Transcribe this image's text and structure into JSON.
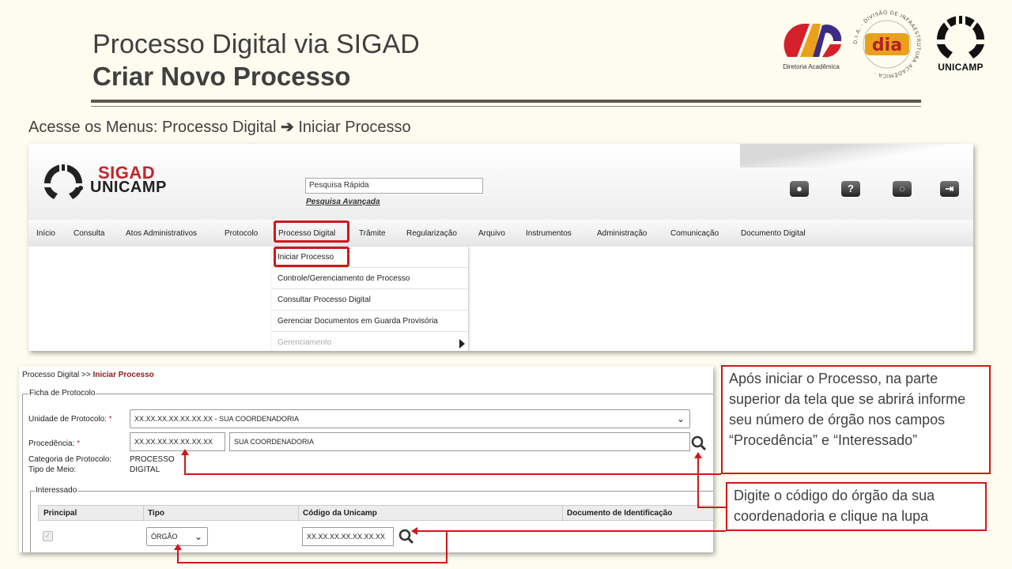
{
  "slide": {
    "title": "Processo Digital via SIGAD",
    "subtitle": "Criar Novo Processo",
    "instruction_prefix": "Acesse os Menus: Processo Digital",
    "instruction_arrow": "➔",
    "instruction_suffix": "Iniciar Processo"
  },
  "logos": {
    "dac_caption": "Diretoria Acadêmica",
    "dia_text": "dia",
    "dia_ring": "D.I.A. · DIVISÃO DE INFRAESTRUTURA ACADÊMICA ·",
    "unicamp_text": "UNICAMP"
  },
  "sigad": {
    "brand_top": "SIGAD",
    "brand_bottom": "UNICAMP",
    "quick_search_placeholder": "Pesquisa Rápida",
    "advanced_search": "Pesquisa Avançada",
    "header_icons": [
      "user-icon",
      "help-icon",
      "chat-icon",
      "exit-icon"
    ],
    "nav": [
      "Início",
      "Consulta",
      "Atos Administrativos",
      "Protocolo",
      "Processo Digital",
      "Trâmite",
      "Regularização",
      "Arquivo",
      "Instrumentos",
      "Administração",
      "Comunicação",
      "Documento Digital"
    ],
    "dropdown": [
      "Iniciar Processo",
      "Controle/Gerenciamento de Processo",
      "Consultar Processo Digital",
      "Gerenciar Documentos em Guarda Provisória",
      "Gerenciamento"
    ]
  },
  "form": {
    "breadcrumb_prefix": "Processo Digital >>",
    "breadcrumb_current": "Iniciar Processo",
    "fieldset_ficha": "Ficha de Protocolo",
    "unidade_label": "Unidade de Protocolo:",
    "unidade_value": "XX.XX.XX.XX.XX.XX.XX - SUA COORDENADORIA",
    "procedencia_label": "Procedência:",
    "procedencia_code": "XX.XX.XX.XX.XX.XX.XX",
    "procedencia_name": "SUA COORDENADORIA",
    "categoria_label": "Categoria de Protocolo:",
    "categoria_value": "PROCESSO",
    "tipo_meio_label": "Tipo de Meio:",
    "tipo_meio_value": "DIGITAL",
    "fieldset_interessado": "Interessado",
    "table_headers": [
      "Principal",
      "Tipo",
      "Código da Unicamp",
      "Documento de Identificação"
    ],
    "tipo_value": "ÓRGÃO",
    "codigo_value": "XX.XX.XX.XX.XX.XX.XX",
    "required_mark": "*"
  },
  "callouts": {
    "first": "Após iniciar o Processo, na parte superior da tela que se abrirá informe seu número de órgão nos campos “Procedência” e “Interessado”",
    "second": "Digite o código do órgão da sua coordenadoria e clique na lupa"
  },
  "colors": {
    "accent_red": "#d0161b",
    "title_gray": "#404040",
    "background": "#fdfcef"
  }
}
